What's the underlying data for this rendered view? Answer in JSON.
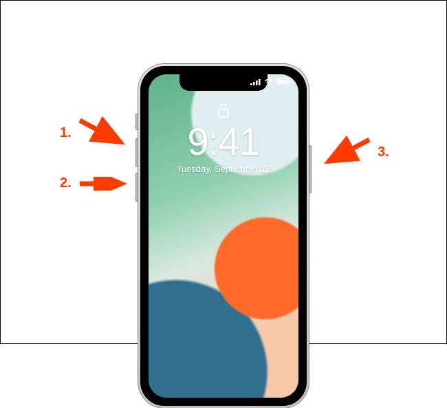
{
  "lockscreen": {
    "time": "9:41",
    "date": "Tuesday, September 12"
  },
  "status": {
    "signal_icon": "cellular-signal-icon",
    "wifi_icon": "wifi-icon",
    "battery_icon": "battery-icon"
  },
  "callouts": [
    {
      "id": 1,
      "label": "1.",
      "target": "volume-up-button"
    },
    {
      "id": 2,
      "label": "2.",
      "target": "volume-down-button"
    },
    {
      "id": 3,
      "label": "3.",
      "target": "side-power-button"
    }
  ],
  "colors": {
    "callout": "#ff3b00",
    "lock_text": "#ffffff"
  }
}
